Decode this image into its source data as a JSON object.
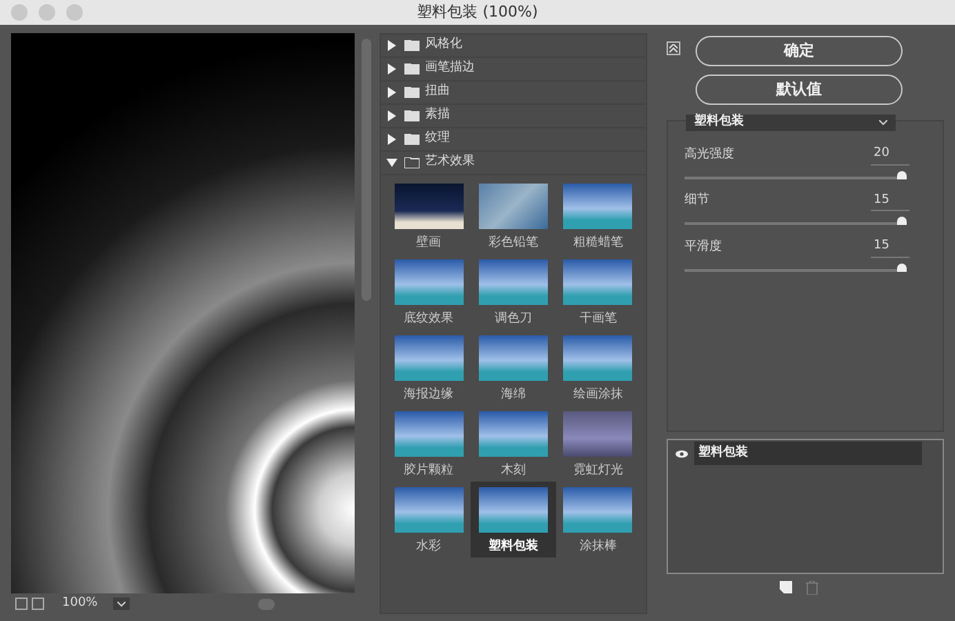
{
  "window": {
    "title": "塑料包装 (100%)"
  },
  "preview": {
    "zoom": "100%"
  },
  "categories": [
    {
      "label": "风格化",
      "expanded": false
    },
    {
      "label": "画笔描边",
      "expanded": false
    },
    {
      "label": "扭曲",
      "expanded": false
    },
    {
      "label": "素描",
      "expanded": false
    },
    {
      "label": "纹理",
      "expanded": false
    },
    {
      "label": "艺术效果",
      "expanded": true
    }
  ],
  "filters": [
    {
      "label": "壁画",
      "selected": false
    },
    {
      "label": "彩色铅笔",
      "selected": false
    },
    {
      "label": "粗糙蜡笔",
      "selected": false
    },
    {
      "label": "底纹效果",
      "selected": false
    },
    {
      "label": "调色刀",
      "selected": false
    },
    {
      "label": "干画笔",
      "selected": false
    },
    {
      "label": "海报边缘",
      "selected": false
    },
    {
      "label": "海绵",
      "selected": false
    },
    {
      "label": "绘画涂抹",
      "selected": false
    },
    {
      "label": "胶片颗粒",
      "selected": false
    },
    {
      "label": "木刻",
      "selected": false
    },
    {
      "label": "霓虹灯光",
      "selected": false
    },
    {
      "label": "水彩",
      "selected": false
    },
    {
      "label": "塑料包装",
      "selected": true
    },
    {
      "label": "涂抹棒",
      "selected": false
    }
  ],
  "buttons": [
    "确定",
    "默认值"
  ],
  "settings": {
    "filter": "塑料包装",
    "params": [
      {
        "label": "高光强度",
        "value": "20",
        "level": 1
      },
      {
        "label": "细节",
        "value": "15",
        "level": 1
      },
      {
        "label": "平滑度",
        "value": "15",
        "level": 1
      }
    ]
  },
  "layers": [
    {
      "label": "塑料包装",
      "visible": true
    }
  ]
}
